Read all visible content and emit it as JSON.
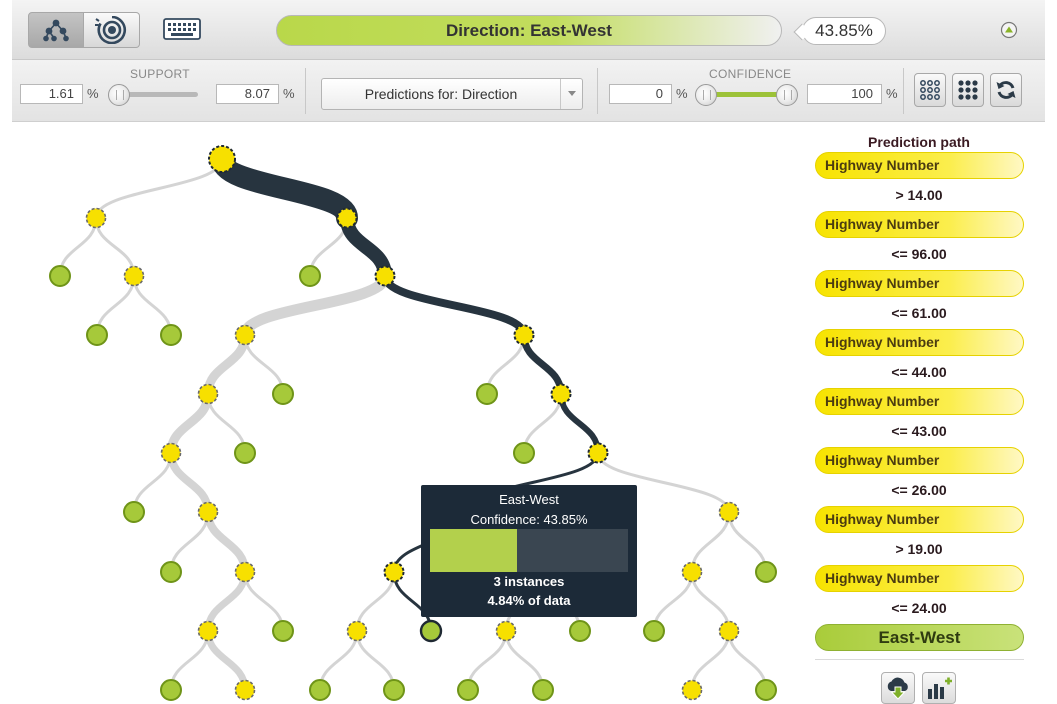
{
  "header": {
    "direction_label": "Direction: East-West",
    "confidence_pct": "43.85%",
    "icons": [
      "tree-view-icon",
      "sunburst-view-icon",
      "keyboard-icon",
      "collapse-arrow-icon"
    ]
  },
  "filters": {
    "support_label": "SUPPORT",
    "support_min": "1.61",
    "support_max": "8.07",
    "pct": "%",
    "predictions_select": "Predictions for: Direction",
    "confidence_label": "CONFIDENCE",
    "confidence_min": "0",
    "confidence_max": "100",
    "tool_icons": [
      "sparse-grid-icon",
      "dense-grid-icon",
      "refresh-icon"
    ]
  },
  "tooltip": {
    "title": "East-West",
    "confidence": "Confidence: 43.85%",
    "confidence_value": 43.85,
    "instances": "3 instances",
    "data_share": "4.84% of data"
  },
  "prediction_path": {
    "title": "Prediction path",
    "steps": [
      {
        "field": "Highway Number",
        "condition": "> 14.00"
      },
      {
        "field": "Highway Number",
        "condition": "<= 96.00"
      },
      {
        "field": "Highway Number",
        "condition": "<= 61.00"
      },
      {
        "field": "Highway Number",
        "condition": "<= 44.00"
      },
      {
        "field": "Highway Number",
        "condition": "<= 43.00"
      },
      {
        "field": "Highway Number",
        "condition": "<= 26.00"
      },
      {
        "field": "Highway Number",
        "condition": "> 19.00"
      },
      {
        "field": "Highway Number",
        "condition": "<= 24.00"
      }
    ],
    "result": "East-West",
    "buttons": [
      "download-model-icon",
      "add-chart-icon"
    ]
  },
  "colors": {
    "split_node": "#f7e000",
    "leaf_node": "#a6c93a",
    "path_link": "#27343f",
    "link": "#d4d4d4",
    "accent_green": "#b3d04c"
  }
}
